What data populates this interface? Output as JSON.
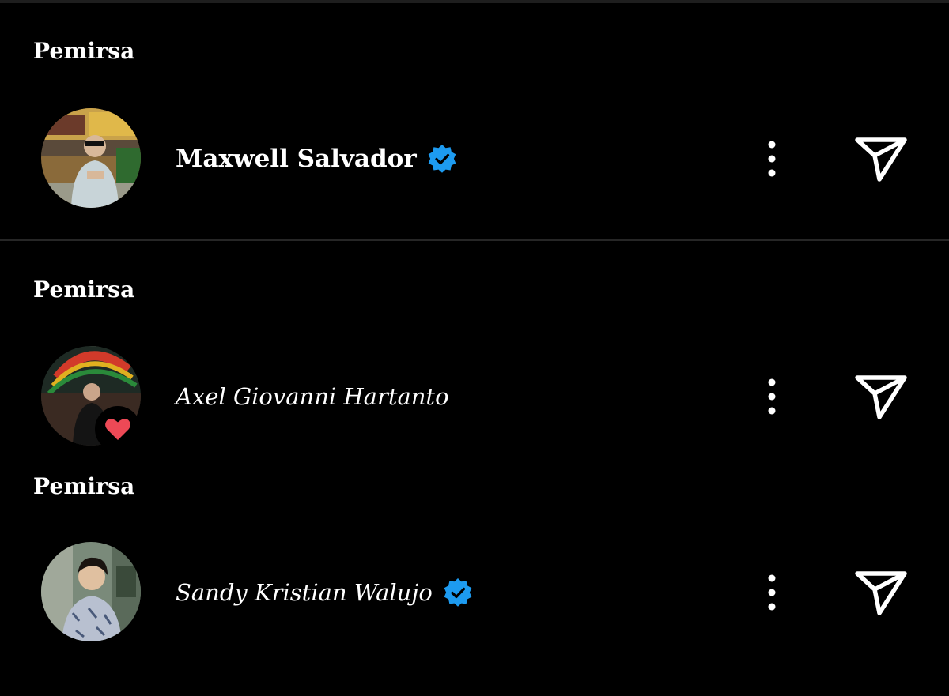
{
  "sections": [
    {
      "title": "Pemirsa",
      "user": {
        "name": "Maxwell Salvador",
        "verified": true,
        "liked": false,
        "avatar_icon": "profile-photo"
      }
    },
    {
      "title": "Pemirsa",
      "user": {
        "name": "Axel Giovanni Hartanto",
        "verified": false,
        "liked": true,
        "avatar_icon": "profile-photo"
      }
    },
    {
      "title": "Pemirsa",
      "user": {
        "name": "Sandy Kristian Walujo",
        "verified": true,
        "liked": false,
        "avatar_icon": "profile-photo"
      }
    }
  ],
  "icons": {
    "verified": "verified-badge-icon",
    "more": "more-vertical-icon",
    "send": "send-icon",
    "heart": "heart-icon"
  },
  "colors": {
    "background": "#000000",
    "text": "#ffffff",
    "verified_blue": "#1d9bf0",
    "heart_red": "#ed4956",
    "divider": "#262626"
  }
}
